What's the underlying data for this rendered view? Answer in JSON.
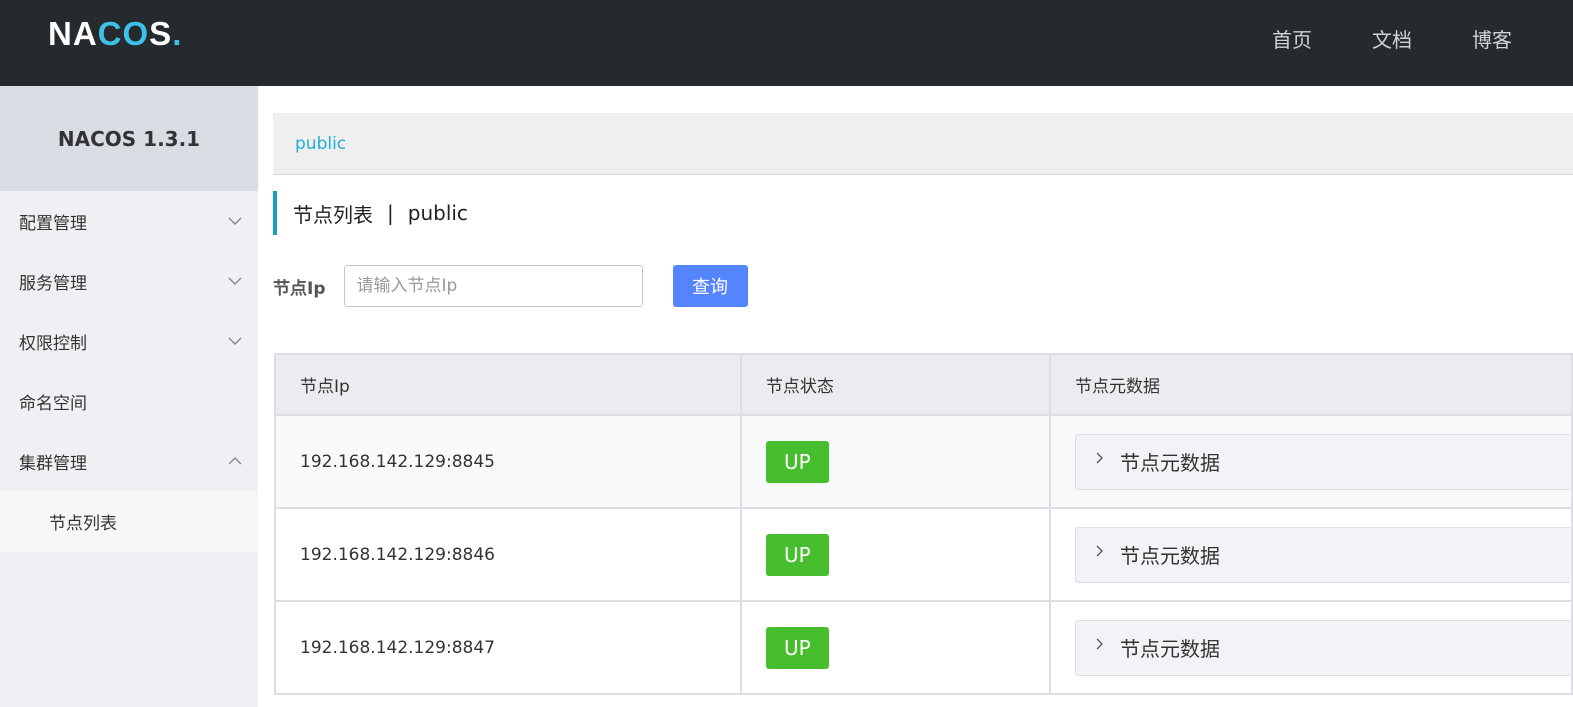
{
  "header": {
    "logo_prefix": "NA",
    "logo_highlight": "CO",
    "logo_suffix": "S",
    "logo_dot": ".",
    "nav": [
      "首页",
      "文档",
      "博客"
    ]
  },
  "sidebar": {
    "version": "NACOS 1.3.1",
    "items": [
      {
        "label": "配置管理",
        "chevron": "down"
      },
      {
        "label": "服务管理",
        "chevron": "down"
      },
      {
        "label": "权限控制",
        "chevron": "down"
      },
      {
        "label": "命名空间",
        "chevron": "none"
      },
      {
        "label": "集群管理",
        "chevron": "up"
      }
    ],
    "sub_items": [
      {
        "label": "节点列表"
      }
    ]
  },
  "main": {
    "namespace": "public",
    "title": "节点列表",
    "title_sep": "|",
    "title_ns": "public",
    "search": {
      "label": "节点Ip",
      "placeholder": "请输入节点Ip",
      "value": "",
      "button": "查询"
    },
    "table": {
      "headers": [
        "节点Ip",
        "节点状态",
        "节点元数据"
      ],
      "rows": [
        {
          "ip": "192.168.142.129:8845",
          "status": "UP",
          "meta": "节点元数据"
        },
        {
          "ip": "192.168.142.129:8846",
          "status": "UP",
          "meta": "节点元数据"
        },
        {
          "ip": "192.168.142.129:8847",
          "status": "UP",
          "meta": "节点元数据"
        }
      ]
    }
  },
  "colors": {
    "header_bg": "#252a2f",
    "accent": "#1fb1d6",
    "button": "#5584ff",
    "status_up": "#46be2d"
  }
}
